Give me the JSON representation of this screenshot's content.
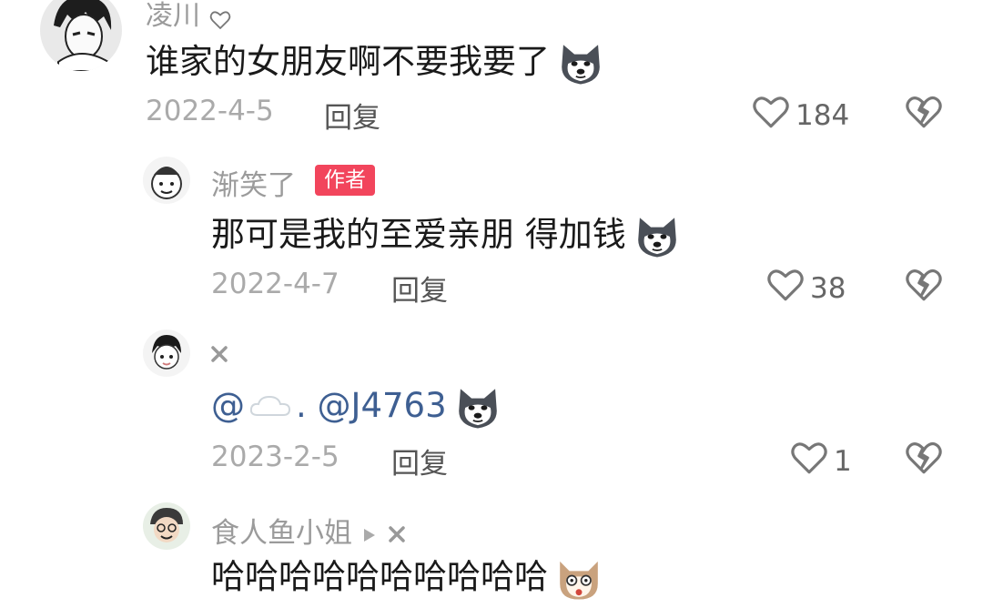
{
  "comments": [
    {
      "username": "凌川",
      "text": "谁家的女朋友啊不要我要了",
      "emoji": "husky-emoji",
      "date": "2022-4-5",
      "reply_label": "回复",
      "likes": "184"
    },
    {
      "username": "渐笑了",
      "badge": "作者",
      "text": "那可是我的至爱亲朋  得加钱",
      "emoji": "husky-emoji",
      "date": "2022-4-7",
      "reply_label": "回复",
      "likes": "38"
    },
    {
      "username_icon": "x-mark",
      "mention1": "@",
      "mention1_icon": "cloud-icon",
      "mention_sep": ".",
      "mention2": "@J4763",
      "emoji": "husky-emoji",
      "date": "2023-2-5",
      "reply_label": "回复",
      "likes": "1"
    },
    {
      "username": "食人鱼小姐",
      "text": "哈哈哈哈哈哈哈哈哈哈",
      "emoji": "shocked-dog-emoji"
    }
  ],
  "colors": {
    "author_badge": "#f2455c",
    "mention": "#3e5f92",
    "meta_gray": "#aaaaaa"
  }
}
